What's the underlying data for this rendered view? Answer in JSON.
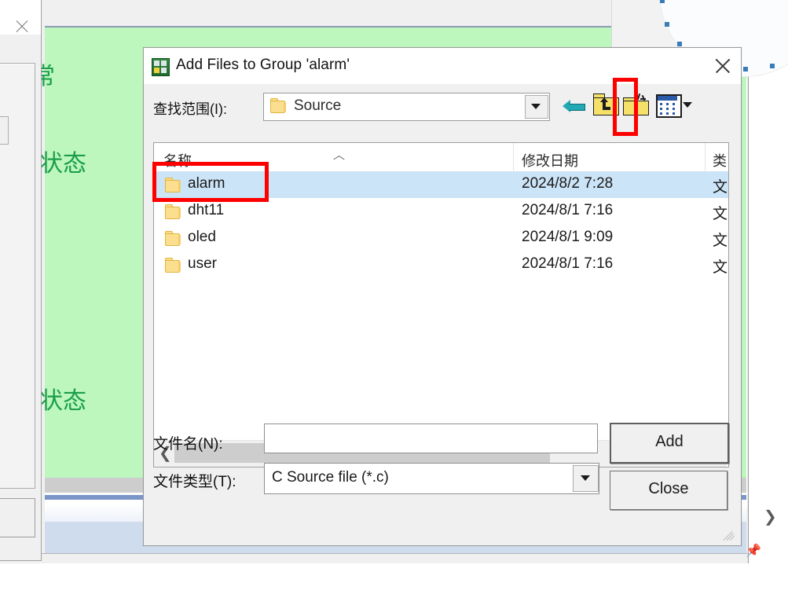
{
  "background_ide": {
    "name": "keil-uvision-editor",
    "code_lines": [
      "常",
      "是关闭状态",
      "是开启状态"
    ],
    "green_comment_color": "#bdf7bd",
    "comment_text_color": "#1a9e4b",
    "pin_icon": "pin-icon"
  },
  "dot_panel": {
    "name": "dotted-arc-panel",
    "dot_color": "#3a7cb8",
    "dot_count": 14
  },
  "dialog": {
    "title": "Add Files to Group 'alarm'",
    "app_icon": "keil-uvision-icon",
    "close_icon": "close-icon",
    "look_in": {
      "label": "查找范围(I):",
      "value": "Source",
      "folder_icon": "folder-icon",
      "dropdown_icon": "chevron-down-icon"
    },
    "toolbar": [
      {
        "name": "back-button",
        "icon": "back-arrow-icon",
        "label": ""
      },
      {
        "name": "up-one-level-button",
        "icon": "folder-up-icon",
        "label": ""
      },
      {
        "name": "new-folder-button",
        "icon": "new-folder-icon",
        "label": ""
      },
      {
        "name": "view-mode-button",
        "icon": "view-grid-icon",
        "label": ""
      }
    ],
    "file_list": {
      "columns": [
        "名称",
        "修改日期",
        "类"
      ],
      "sort_indicator": "︿",
      "rows": [
        {
          "name": "alarm",
          "date": "2024/8/2 7:28",
          "type": "文",
          "icon": "folder-icon",
          "selected": true
        },
        {
          "name": "dht11",
          "date": "2024/8/1 7:16",
          "type": "文",
          "icon": "folder-icon",
          "selected": false
        },
        {
          "name": "oled",
          "date": "2024/8/1 9:09",
          "type": "文",
          "icon": "folder-icon",
          "selected": false
        },
        {
          "name": "user",
          "date": "2024/8/1 7:16",
          "type": "文",
          "icon": "folder-icon",
          "selected": false
        }
      ],
      "hscroll_left_icon": "❮",
      "hscroll_right_icon": "❯"
    },
    "file_name": {
      "label": "文件名(N):",
      "value": "",
      "placeholder": ""
    },
    "file_type": {
      "label": "文件类型(T):",
      "value": "C Source file (*.c)",
      "dropdown_icon": "chevron-down-icon"
    },
    "buttons": {
      "add": "Add",
      "close": "Close"
    },
    "resize_grip": "resize-grip"
  },
  "annotations": {
    "highlight_color": "#fe0000",
    "boxes": [
      {
        "name": "new-folder-highlight",
        "target": "new-folder-button"
      },
      {
        "name": "alarm-row-highlight",
        "target": "alarm-folder-row"
      }
    ]
  },
  "left_dialog": {
    "name": "partially-visible-dialog",
    "close_icon": "close-icon"
  },
  "right_scroll_arrow": "❯"
}
